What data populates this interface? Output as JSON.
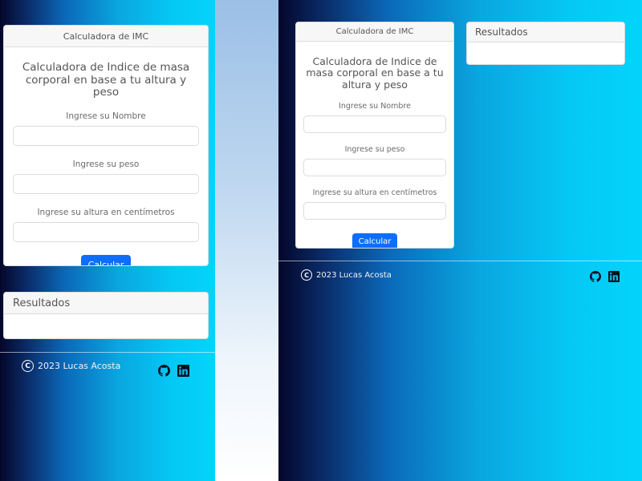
{
  "form": {
    "header": "Calculadora de IMC",
    "heading": "Calculadora de Indice de masa corporal en base a tu altura y peso",
    "fields": [
      {
        "label": "Ingrese su Nombre",
        "value": ""
      },
      {
        "label": "Ingrese su peso",
        "value": ""
      },
      {
        "label": "Ingrese su altura en centímetros",
        "value": ""
      }
    ],
    "submit_label": "Calcular"
  },
  "results": {
    "header": "Resultados"
  },
  "footer": {
    "copyright_symbol": "C",
    "text": "2023 Lucas Acosta",
    "social": [
      "github-icon",
      "linkedin-icon"
    ]
  },
  "colors": {
    "accent": "#0d6efd",
    "gradient_dark": "#04062a",
    "gradient_light": "#03d4fb",
    "card_header_bg": "#f7f7f7"
  }
}
